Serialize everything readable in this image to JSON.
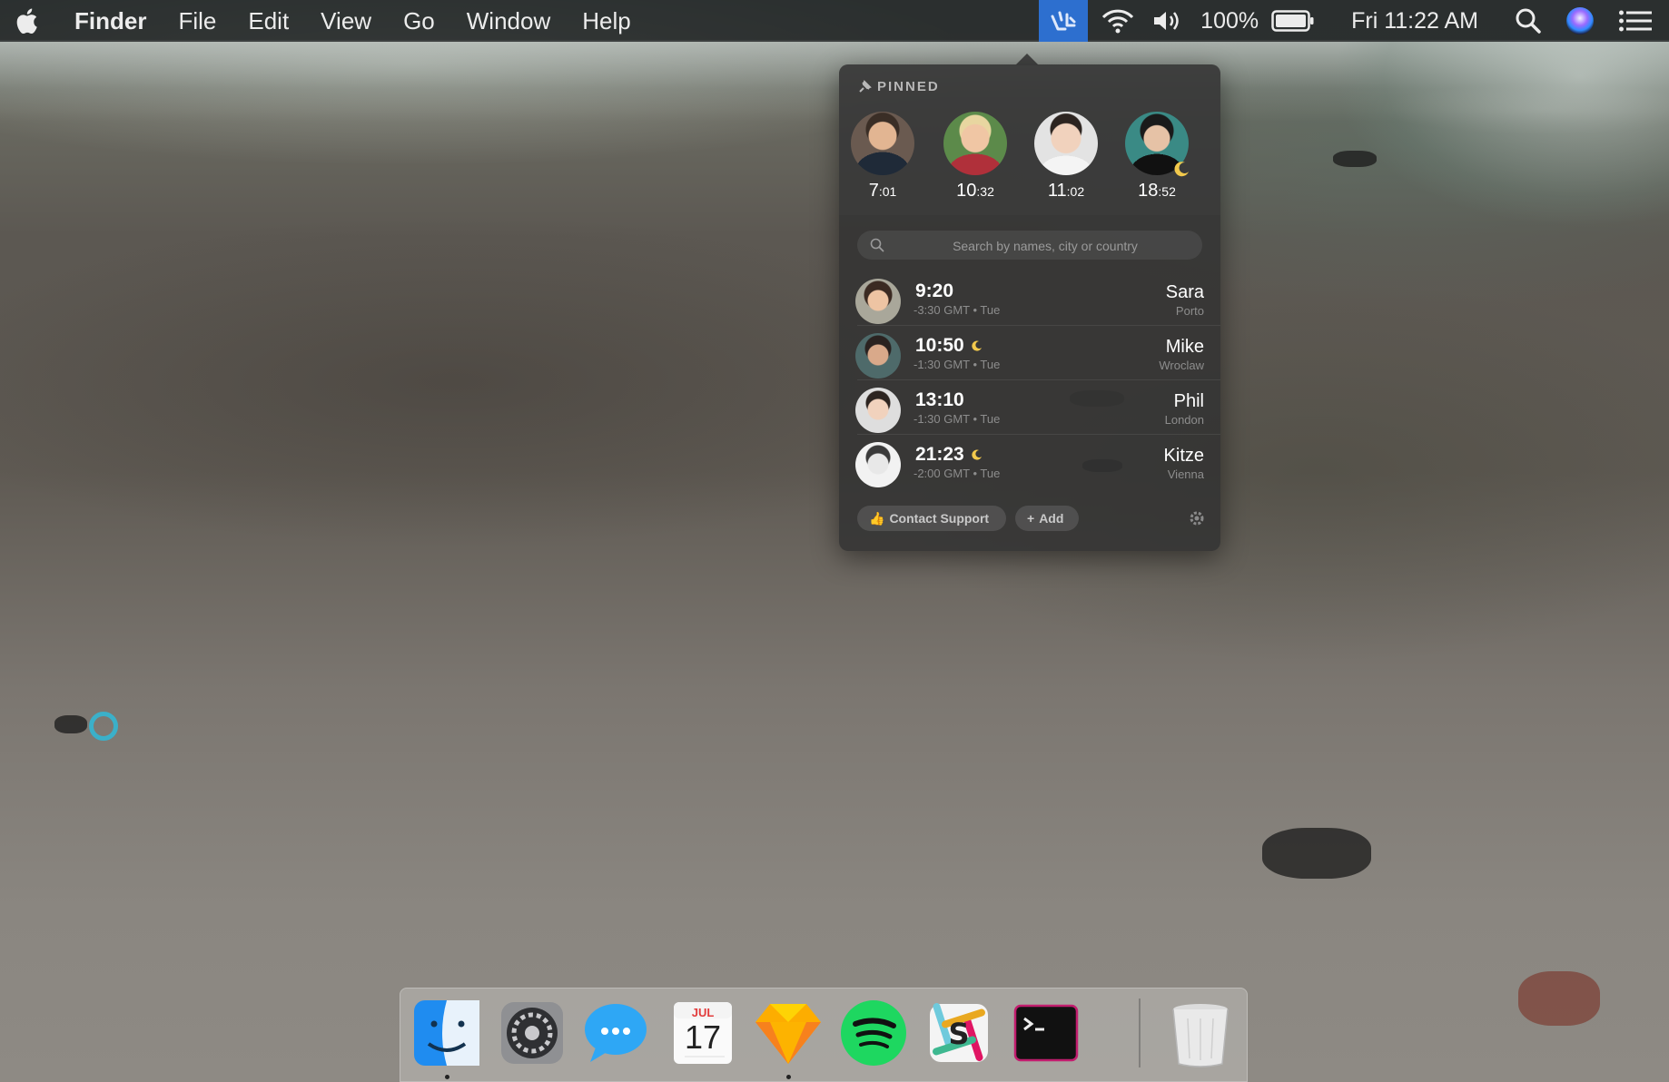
{
  "menubar": {
    "app_name": "Finder",
    "items": [
      "File",
      "Edit",
      "View",
      "Go",
      "Window",
      "Help"
    ],
    "battery": "100%",
    "clock": "Fri 11:22 AM",
    "icons": [
      "apple-logo",
      "timezone-app-icon",
      "wifi-icon",
      "volume-icon",
      "battery-icon",
      "spotlight-search-icon",
      "siri-icon",
      "notification-center-icon"
    ],
    "accent": "#2d6fcf"
  },
  "popover": {
    "pinned_label": "PINNED",
    "pinned": [
      {
        "hour": "7",
        "min": ":01",
        "avatar_color": "#6a5a50"
      },
      {
        "hour": "10",
        "min": ":32",
        "avatar_color": "#5c8a4a"
      },
      {
        "hour": "11",
        "min": ":02",
        "avatar_color": "#e3e3e3"
      },
      {
        "hour": "18",
        "min": ":52",
        "avatar_color": "#3a8a85",
        "night": true
      }
    ],
    "search_placeholder": "Search by names, city or country",
    "people": [
      {
        "time": "9:20",
        "offset": "-3:30 GMT • Tue",
        "name": "Sara",
        "city": "Porto",
        "night": false
      },
      {
        "time": "10:50",
        "offset": "-1:30 GMT • Tue",
        "name": "Mike",
        "city": "Wroclaw",
        "night": true
      },
      {
        "time": "13:10",
        "offset": "-1:30 GMT • Tue",
        "name": "Phil",
        "city": "London",
        "night": false
      },
      {
        "time": "21:23",
        "offset": "-2:00 GMT • Tue",
        "name": "Kitze",
        "city": "Vienna",
        "night": true
      }
    ],
    "contact_support": "Contact Support",
    "add_label": "Add",
    "moon_color": "#f2c94c"
  },
  "dock": {
    "apps": [
      "Finder",
      "System Preferences",
      "Messages",
      "Calendar",
      "Sketch",
      "Spotify",
      "Slack",
      "Terminal",
      "Trash"
    ],
    "calendar_month": "JUL",
    "calendar_day": "17"
  }
}
